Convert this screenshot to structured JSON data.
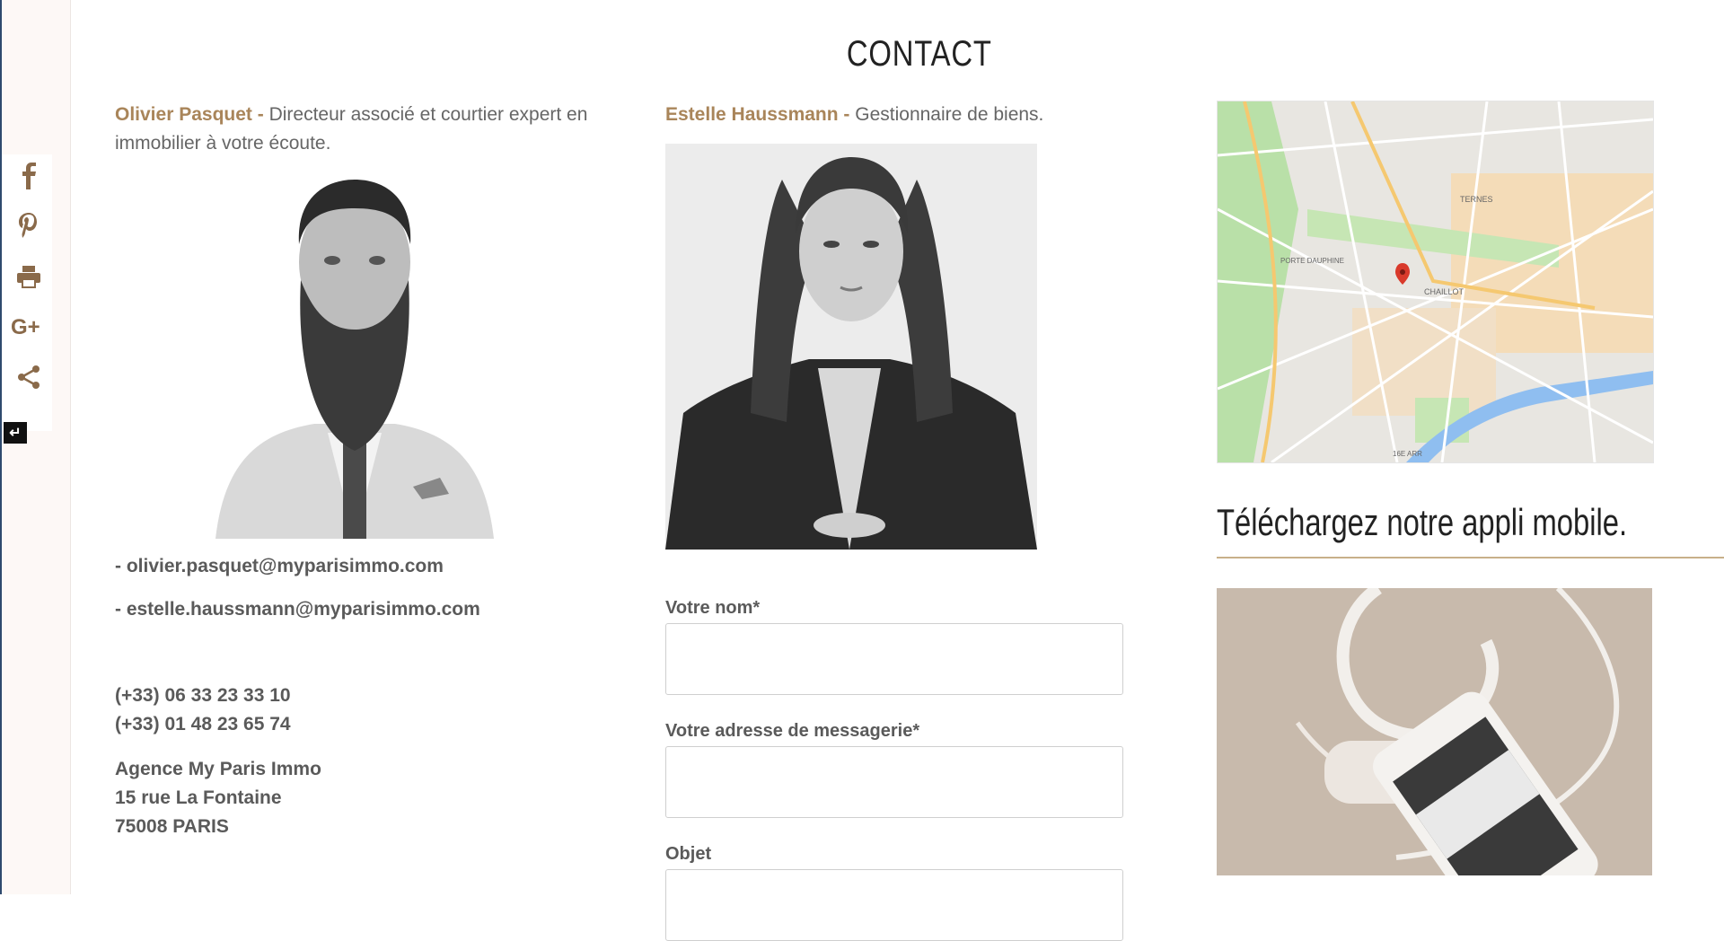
{
  "page": {
    "title": "CONTACT"
  },
  "share_rail": {
    "icons": [
      "facebook-icon",
      "pinterest-icon",
      "print-icon",
      "google-plus-icon",
      "share-icon"
    ],
    "toggle_glyph": "↵"
  },
  "contacts": [
    {
      "name": "Olivier Pasquet -",
      "role": "Directeur associé et courtier expert en immobilier à votre écoute."
    },
    {
      "name": "Estelle Haussmann -",
      "role": "Gestionnaire de biens."
    }
  ],
  "emails": [
    "- olivier.pasquet@myparisimmo.com",
    "- estelle.haussmann@myparisimmo.com"
  ],
  "phones": [
    "(+33) 06 33 23 33 10",
    "(+33) 01 48 23 65 74"
  ],
  "address": [
    "Agence My Paris Immo",
    "15 rue La Fontaine",
    "75008 PARIS"
  ],
  "form": {
    "name_label": "Votre nom*",
    "email_label": "Votre adresse de messagerie*",
    "subject_label": "Objet",
    "name_value": "",
    "email_value": "",
    "subject_value": ""
  },
  "map": {
    "labels": [
      "TERNES",
      "PORTE DAUPHINE",
      "CHAILLOT",
      "16E ARR"
    ]
  },
  "app": {
    "title": "Téléchargez notre appli mobile."
  },
  "colors": {
    "accent": "#a9855a",
    "rail_bg": "#fdf8f6",
    "seine": "#8fbef0"
  }
}
